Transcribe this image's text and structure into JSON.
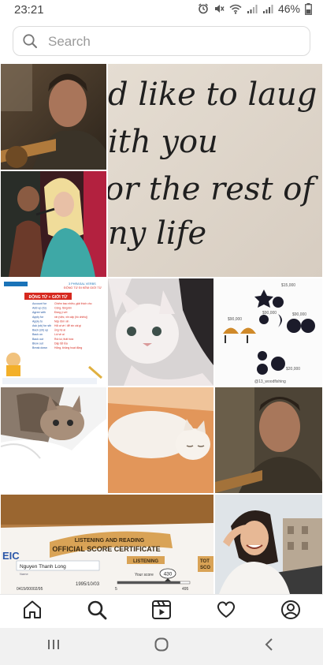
{
  "status_bar": {
    "time": "23:21",
    "battery": "46%",
    "icons": [
      "alarm-icon",
      "mute-icon",
      "wifi-icon",
      "signal-icon",
      "signal-icon",
      "battery-icon"
    ]
  },
  "search": {
    "placeholder": "Search",
    "value": ""
  },
  "explore_grid": {
    "handwritten_note": {
      "lines": [
        "d like to laug",
        "ith you",
        "or the rest of",
        "ny life"
      ]
    },
    "vocab_card": {
      "header_line1": "3 PHRASAL VERBS",
      "header_line2": "ĐỘNG TỪ ĐI KÈM GIỚI TỪ",
      "banner": "ĐỘNG TỪ + GIỚI TỪ",
      "rows": [
        [
          "Account for",
          "Chiếm bao nhiêu, giải thích cho"
        ],
        [
          "Add up (to)",
          "Cộng, tăng lên"
        ],
        [
          "Agree with",
          "Đồng ý với"
        ],
        [
          "Apply for",
          "xin (việc, xin cấp (hồ chiếu))"
        ],
        [
          "Apply to",
          "Nộp đơn xin"
        ],
        [
          "Ask (sb) for sth",
          "Hỏi ai về / để xin cái gì"
        ],
        [
          "Back (sb) up",
          "ủng hộ ai"
        ],
        [
          "Back on",
          "Lùi về ai"
        ],
        [
          "Back out",
          "Rút lui, thất hứa"
        ],
        [
          "Blow out",
          "Dập tắt lửa"
        ],
        [
          "Break down",
          "Hỏng, không hoạt động"
        ]
      ]
    },
    "earrings": {
      "prices": [
        "$15,000",
        "$90,000",
        "$90,000",
        "$90,000",
        "$20,000"
      ],
      "handle": "@13_woodfishing"
    },
    "certificate": {
      "logo_fragment": "EIC",
      "title_line1": "LISTENING AND READING",
      "title_line2": "OFFICIAL SCORE CERTIFICATE",
      "listening_label": "LISTENING",
      "total_label": "TOT",
      "total_label2": "SCO",
      "name": "Nguyen Thanh Long",
      "name_label": "Name",
      "dob": "1995/10/03",
      "id_fragment": "0415/00002/95",
      "score_label": "Your score",
      "score": "430",
      "scale_min": "5",
      "scale_max": "495"
    }
  },
  "bottom_nav": {
    "items": [
      "home-icon",
      "search-icon",
      "reels-icon",
      "heart-icon",
      "profile-icon"
    ]
  },
  "system_nav": {
    "items": [
      "recent-apps-icon",
      "home-circle-icon",
      "back-icon"
    ]
  }
}
